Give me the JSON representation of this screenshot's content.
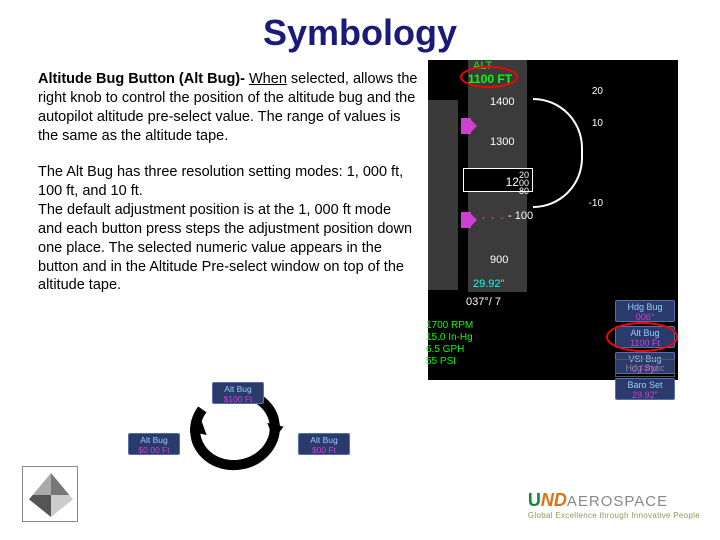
{
  "title": "Symbology",
  "para1": {
    "bold": "Altitude Bug Button (Alt Bug)- ",
    "underline": "When",
    "rest": " selected, allows the right knob to control the position of the altitude bug and the autopilot altitude pre-select value. The range of values is the same as the altitude tape."
  },
  "para2": "The Alt Bug has three resolution setting modes: 1, 000 ft, 100 ft, and 10 ft.\nThe default adjustment position is at the 1, 000 ft mode and each button press steps the adjustment position down one place. The selected numeric value appears in the button and in the Altitude Pre-select window on top of the altitude tape.",
  "pfd": {
    "alt_label": "ALT",
    "preselect": "1100 FT",
    "ticks": {
      "t1": "1400",
      "t2": "1300",
      "t3": "- 100",
      "t4": "900"
    },
    "readout_main": "12",
    "readout_tens_top": "20",
    "readout_tens_mid": "00",
    "readout_tens_bot": "80",
    "dashed": "- - - -",
    "baro": "29.92\"",
    "vsi_top": "20",
    "vsi_up": "10",
    "vsi_dn": "-10",
    "hdg": "037°/ 7",
    "eng_rpm": "1700 RPM",
    "eng_mp": "15.0 In-Hg",
    "eng_gph": "6.5 GPH",
    "eng_psi": "55 PSI"
  },
  "softkeys": {
    "hdg": {
      "label": "Hdg Bug",
      "value": "006°"
    },
    "alt": {
      "label": "Alt Bug",
      "value": "1100 Ft"
    },
    "vsi": {
      "label": "VSI Bug",
      "value": "0 FPM"
    },
    "baro": {
      "label": "Baro Set",
      "value": "29.92\""
    },
    "sync": "Hdg Sync"
  },
  "cycle": {
    "top": {
      "label": "Alt Bug",
      "value": "$100 Ft"
    },
    "left": {
      "label": "Alt Bug",
      "value": "$0 00 Ft"
    },
    "right": {
      "label": "Alt Bug",
      "value": "$00 Ft"
    }
  },
  "footer": {
    "brand_u": "U",
    "brand_nd": "ND",
    "brand_aero": "AEROSPACE",
    "tagline": "Global Excellence through Innovative People"
  }
}
